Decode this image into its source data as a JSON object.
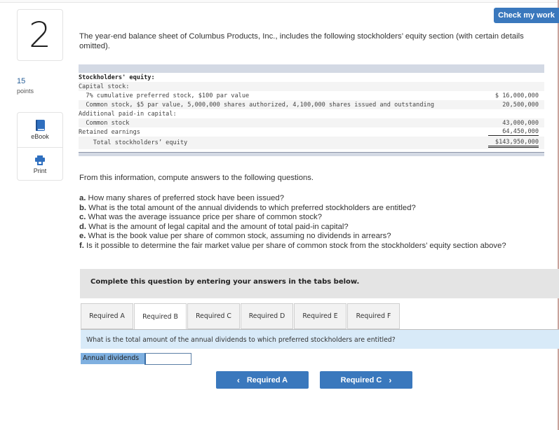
{
  "question": {
    "number": "2",
    "points_value": "15",
    "points_label": "points"
  },
  "tools": [
    {
      "label": "eBook",
      "icon": "book-icon"
    },
    {
      "label": "Print",
      "icon": "printer-icon"
    }
  ],
  "header": {
    "check_button": "Check my work"
  },
  "intro": "The year-end balance sheet of Columbus Products, Inc., includes the following stockholders’ equity section (with certain details omitted).",
  "balance_sheet": {
    "rows": [
      {
        "label": "Stockholders' equity:",
        "amount": ""
      },
      {
        "label": "Capital stock:",
        "amount": ""
      },
      {
        "label": "  7% cumulative preferred stock, $100 par value",
        "amount": "$ 16,000,000"
      },
      {
        "label": "  Common stock, $5 par value, 5,000,000 shares authorized, 4,100,000 shares issued and outstanding",
        "amount": "20,500,000"
      },
      {
        "label": "Additional paid-in capital:",
        "amount": ""
      },
      {
        "label": "  Common stock",
        "amount": "43,000,000"
      },
      {
        "label": "Retained earnings",
        "amount": "64,450,000"
      },
      {
        "label": "    Total stockholders’ equity",
        "amount": "$143,950,000"
      }
    ]
  },
  "instructions": "From this information, compute answers to the following questions.",
  "questions": [
    {
      "letter": "a.",
      "text": " How many shares of preferred stock have been issued?"
    },
    {
      "letter": "b.",
      "text": " What is the total amount of the annual dividends to which preferred stockholders are entitled?"
    },
    {
      "letter": "c.",
      "text": " What was the average issuance price per share of common stock?"
    },
    {
      "letter": "d.",
      "text": " What is the amount of legal capital and the amount of total paid-in capital?"
    },
    {
      "letter": "e.",
      "text": " What is the book value per share of common stock, assuming no dividends in arrears?"
    },
    {
      "letter": "f.",
      "text": " Is it possible to determine the fair market value per share of common stock from the stockholders’ equity section above?"
    }
  ],
  "complete_banner": "Complete this question by entering your answers in the tabs below.",
  "tabs": [
    {
      "label": "Required A",
      "active": false
    },
    {
      "label": "Required B",
      "active": true
    },
    {
      "label": "Required C",
      "active": false
    },
    {
      "label": "Required D",
      "active": false
    },
    {
      "label": "Required E",
      "active": false
    },
    {
      "label": "Required F",
      "active": false
    }
  ],
  "active_prompt": "What is the total amount of the annual dividends to which preferred stockholders are entitled?",
  "answer": {
    "label": "Annual dividends",
    "value": ""
  },
  "navigation": {
    "prev_label": "Required A",
    "next_label": "Required C",
    "prev_icon": "‹",
    "next_icon": "›"
  }
}
